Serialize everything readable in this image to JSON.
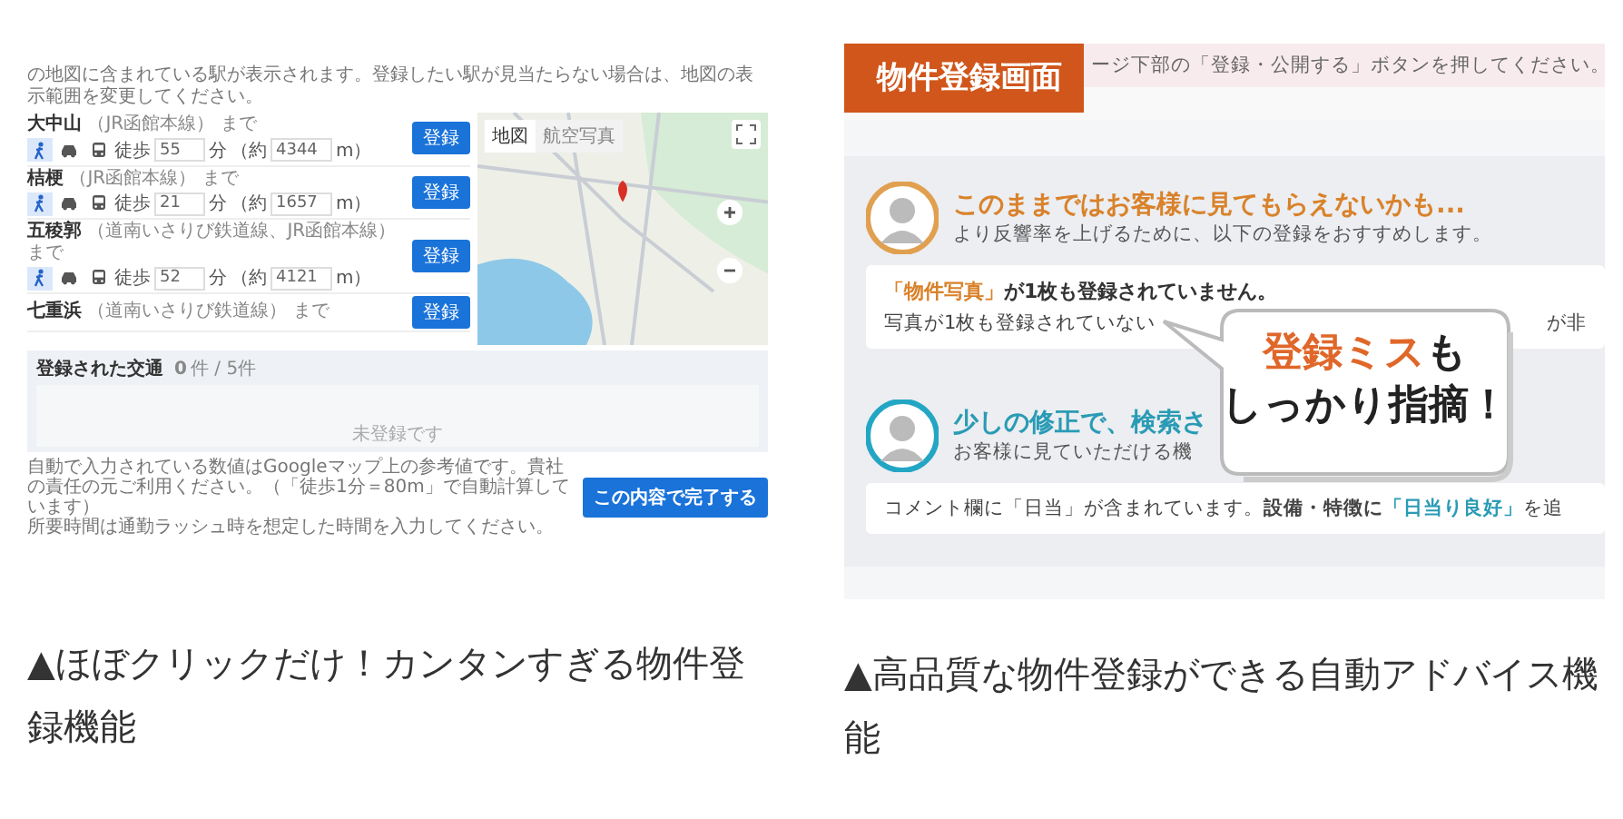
{
  "left_screenshot": {
    "instruction": "の地図に含まれている駅が表示されます。登録したい駅が見当たらない場合は、地図の表示範囲を変更してください。",
    "stations": [
      {
        "name": "大中山",
        "lines": "（JR函館本線）",
        "suffix": "まで",
        "modes": [
          {
            "kind": "walk",
            "selected": true
          },
          {
            "kind": "car",
            "selected": false
          },
          {
            "kind": "bus",
            "selected": false
          }
        ],
        "walk_label": "徒歩",
        "minutes": "55",
        "minutes_unit": "分",
        "approx_label": "（約",
        "distance": "4344",
        "distance_unit": "m）",
        "button": "登録"
      },
      {
        "name": "桔梗",
        "lines": "（JR函館本線）",
        "suffix": "まで",
        "modes": [
          {
            "kind": "walk",
            "selected": true
          },
          {
            "kind": "car",
            "selected": false
          },
          {
            "kind": "bus",
            "selected": false
          }
        ],
        "walk_label": "徒歩",
        "minutes": "21",
        "minutes_unit": "分",
        "approx_label": "（約",
        "distance": "1657",
        "distance_unit": "m）",
        "button": "登録"
      },
      {
        "name": "五稜郭",
        "lines": "（道南いさりび鉄道線、JR函館本線）",
        "suffix": "まで",
        "modes": [
          {
            "kind": "walk",
            "selected": true
          },
          {
            "kind": "car",
            "selected": false
          },
          {
            "kind": "bus",
            "selected": false
          }
        ],
        "walk_label": "徒歩",
        "minutes": "52",
        "minutes_unit": "分",
        "approx_label": "（約",
        "distance": "4121",
        "distance_unit": "m）",
        "button": "登録"
      },
      {
        "name": "七重浜",
        "lines": "（道南いさりび鉄道線）",
        "suffix": "まで",
        "button": "登録"
      }
    ],
    "map": {
      "tabs": [
        {
          "label": "地図",
          "selected": true
        },
        {
          "label": "航空写真",
          "selected": false
        }
      ]
    },
    "registered": {
      "title": "登録された交通",
      "count": "0",
      "count_suffix": "件 / 5件",
      "empty": "未登録です"
    },
    "notes": [
      "自動で入力されている数値はGoogleマップ上の参考値です。貴社の責任の元ご利用ください。（「徒歩1分＝80m」で自動計算しています）",
      "所要時間は通勤ラッシュ時を想定した時間を入力してください。"
    ],
    "complete_button": "この内容で完了する"
  },
  "right_screenshot": {
    "label": "物件登録画面",
    "banner": "ージ下部の「登録・公開する」ボタンを押してください。",
    "sections": [
      {
        "kind": "warning",
        "heading": "このままではお客様に見てもらえないかも...",
        "subtext": "より反響率を上げるために、以下の登録をおすすめします。",
        "card_title_highlight": "「物件写真」",
        "card_title_rest": "が1枚も登録されていません。",
        "card_body": "写真が1枚も登録されていない",
        "card_body_right": "が非"
      },
      {
        "kind": "tip",
        "heading": "少しの修正で、検索さ",
        "subtext": "お客様に見ていただける機",
        "card_body": "コメント欄に「日当」が含まれています。**設備・特徴に**",
        "card_highlight": "「日当り良好」",
        "card_body_rest": "を追"
      }
    ],
    "bubble": {
      "highlight": "登録ミス",
      "rest": "も",
      "line2": "しっかり指摘！"
    }
  },
  "captions": [
    "▲ほぼクリックだけ！カンタンすぎる物件登録機能",
    "▲高品質な物件登録ができる自動アドバイス機能"
  ]
}
